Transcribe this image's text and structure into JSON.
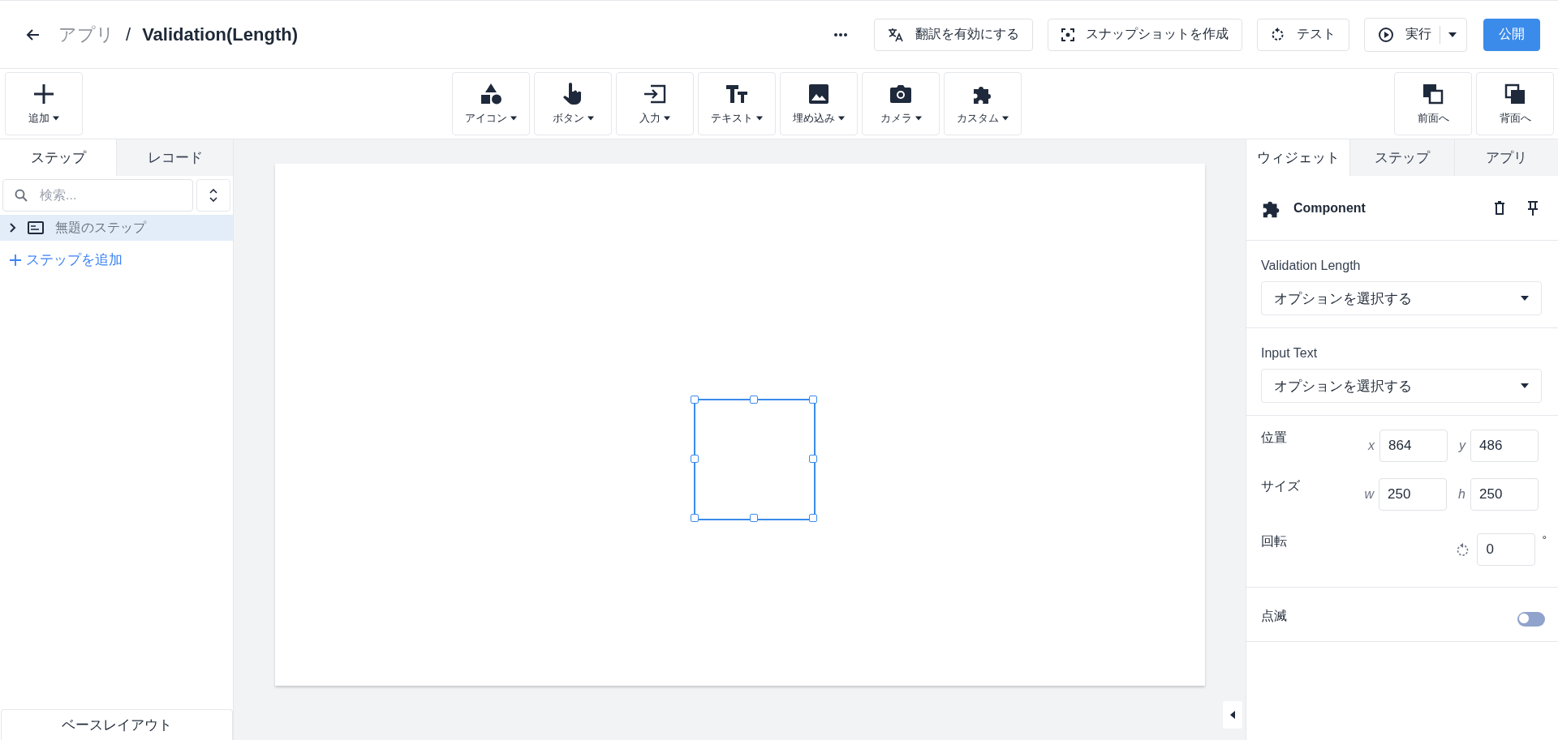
{
  "header": {
    "breadcrumb": "アプリ",
    "separator": "/",
    "title": "Validation(Length)",
    "actions": [
      {
        "kind": "translate",
        "label": "翻訳を有効にする"
      },
      {
        "kind": "snapshot",
        "label": "スナップショットを作成"
      },
      {
        "kind": "test",
        "label": "テスト"
      },
      {
        "kind": "run",
        "label": "実行"
      },
      {
        "kind": "publish",
        "label": "公開"
      }
    ]
  },
  "toolbar": {
    "add": {
      "label": "追加"
    },
    "insert": [
      {
        "kind": "shapes",
        "label": "アイコン"
      },
      {
        "kind": "pointer",
        "label": "ボタン"
      },
      {
        "kind": "input",
        "label": "入力"
      },
      {
        "kind": "text",
        "label": "テキスト"
      },
      {
        "kind": "image",
        "label": "埋め込み"
      },
      {
        "kind": "camera",
        "label": "カメラ"
      },
      {
        "kind": "puzzle",
        "label": "カスタム"
      }
    ],
    "arrange": [
      {
        "kind": "front",
        "label": "前面へ"
      },
      {
        "kind": "back",
        "label": "背面へ"
      }
    ]
  },
  "left_panel": {
    "tabs": [
      {
        "label": "ステップ",
        "selected": true
      },
      {
        "label": "レコード",
        "selected": false
      }
    ],
    "search": {
      "placeholder": "検索..."
    },
    "steps": [
      {
        "label": "無題のステップ",
        "expanded": false,
        "selected": true
      }
    ],
    "add_step": "ステップを追加",
    "base_layout": "ベースレイアウト"
  },
  "canvas": {
    "widget_selected": true
  },
  "right_panel": {
    "tabs": [
      {
        "label": "ウィジェット",
        "selected": true
      },
      {
        "label": "ステップ",
        "selected": false
      },
      {
        "label": "アプリ",
        "selected": false
      }
    ],
    "widget": {
      "name": "Component"
    },
    "properties": [
      {
        "label": "Validation Length",
        "placeholder": "オプションを選択する"
      },
      {
        "label": "Input Text",
        "placeholder": "オプションを選択する"
      }
    ],
    "transform": [
      {
        "kind": "pair",
        "label": "位置",
        "fields": [
          {
            "axis": "x",
            "value": "864"
          },
          {
            "axis": "y",
            "value": "486"
          }
        ]
      },
      {
        "kind": "pair",
        "label": "サイズ",
        "fields": [
          {
            "axis": "w",
            "value": "250"
          },
          {
            "axis": "h",
            "value": "250"
          }
        ]
      },
      {
        "kind": "rotation",
        "label": "回転",
        "fields": [
          {
            "value": "0",
            "unit": "°"
          }
        ]
      }
    ],
    "blink": {
      "label": "点滅",
      "on": false
    }
  }
}
